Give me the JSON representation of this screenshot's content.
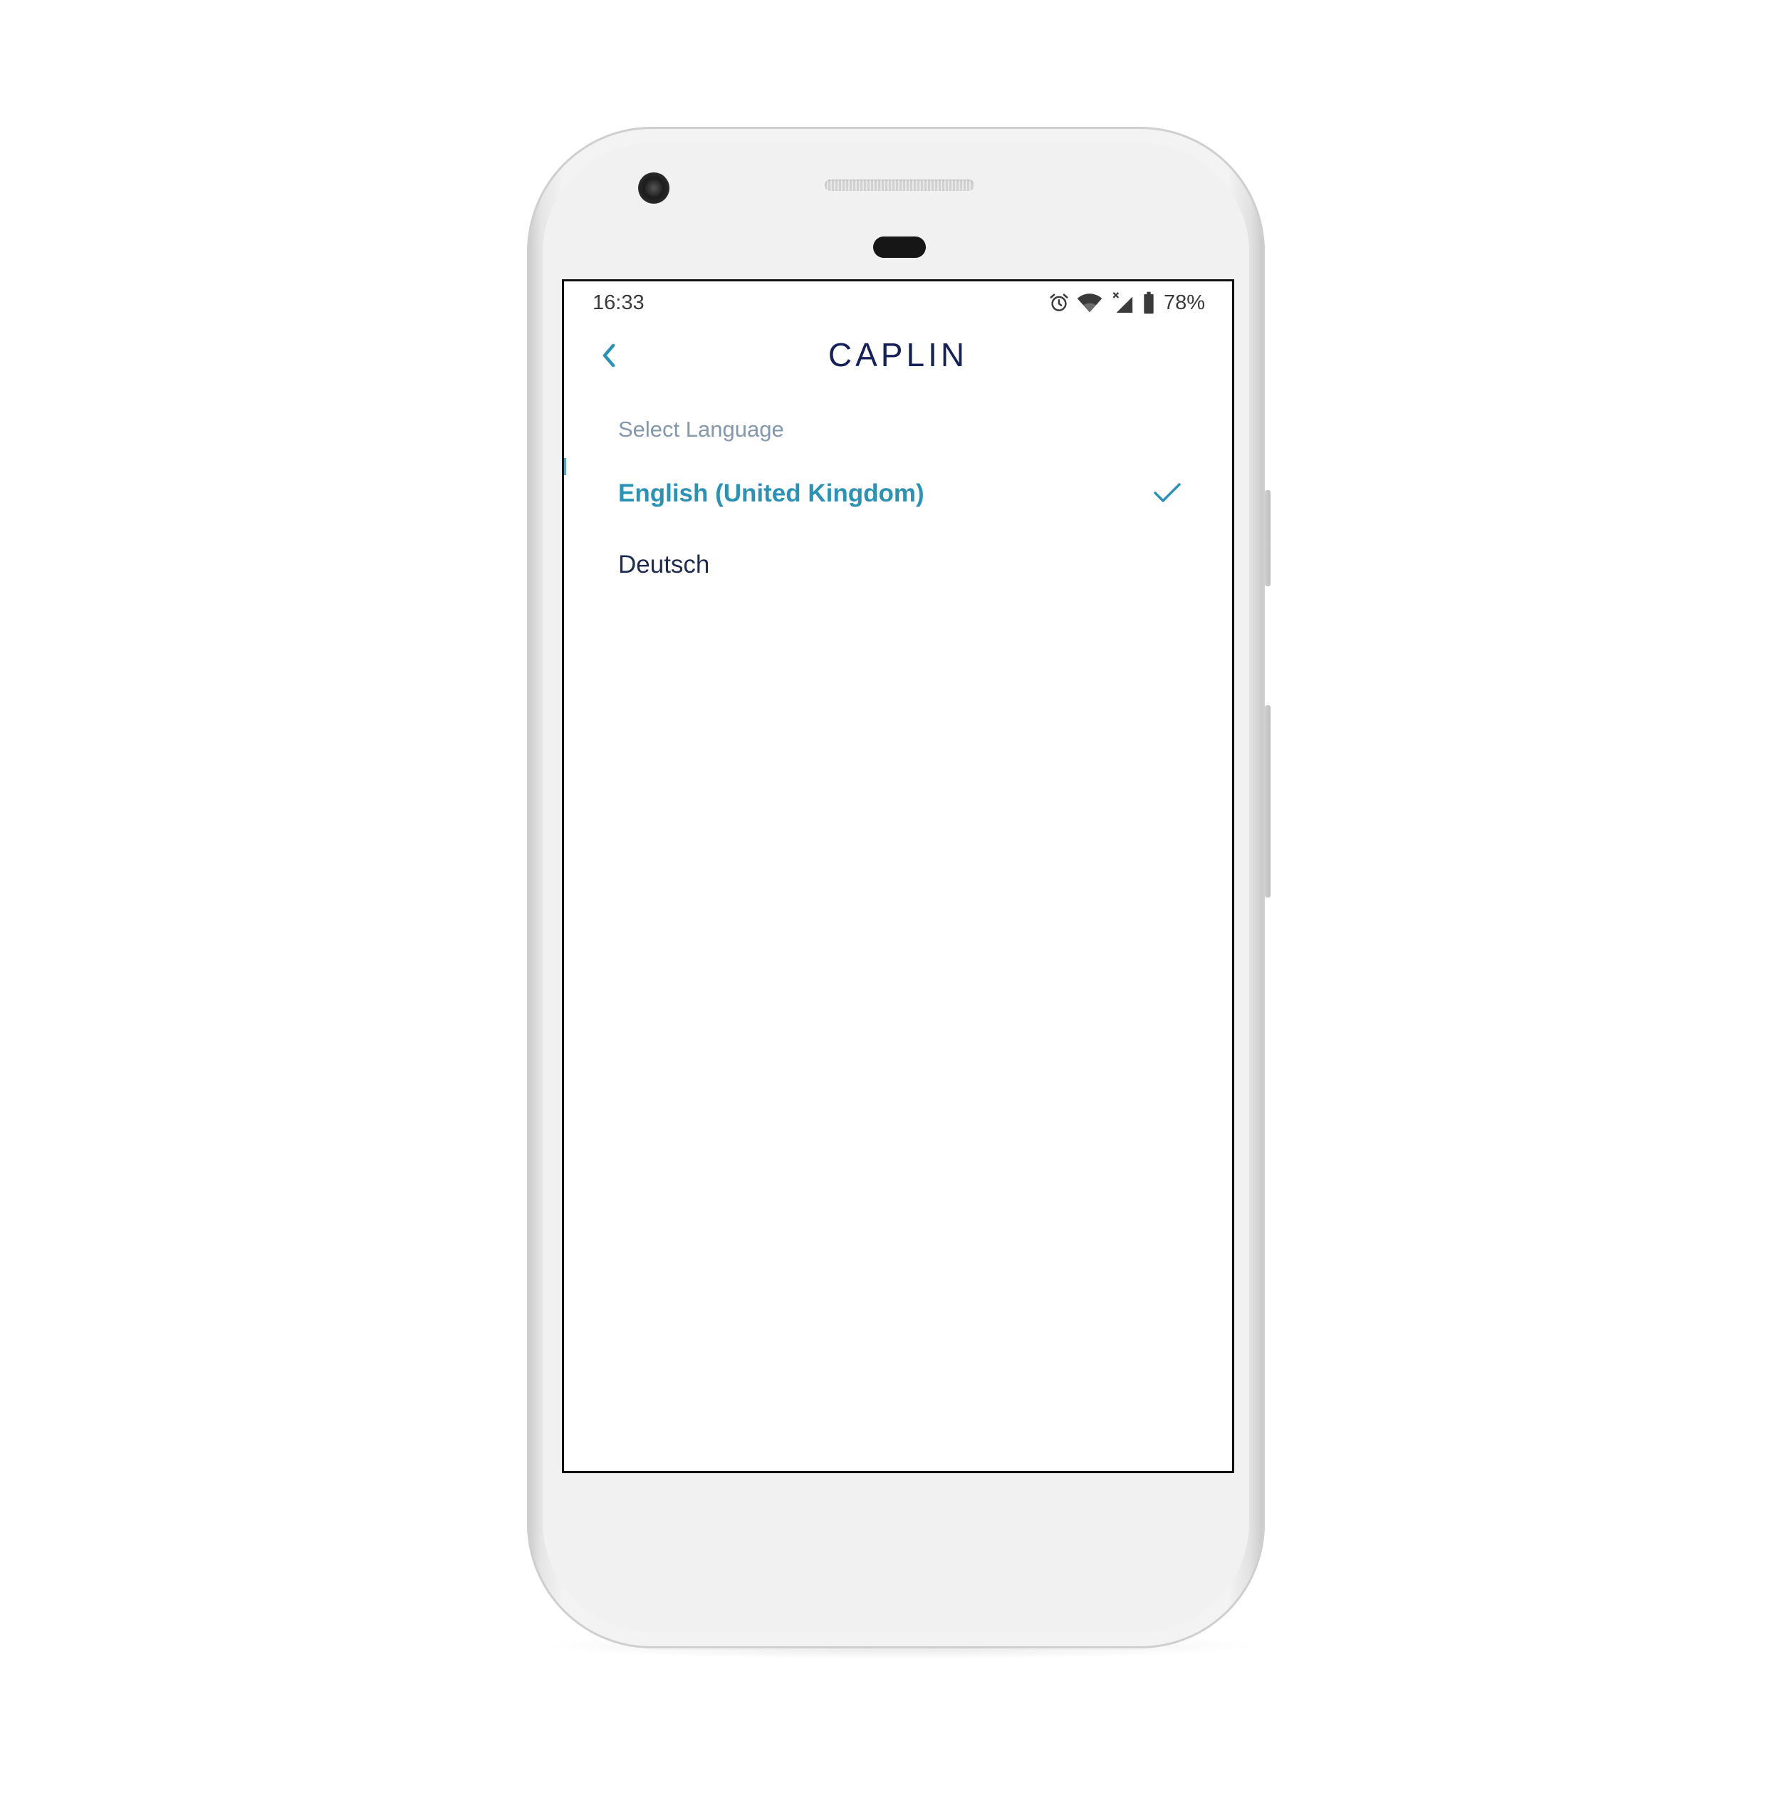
{
  "status_bar": {
    "time": "16:33",
    "battery": "78%",
    "icons": [
      "alarm-icon",
      "wifi-icon",
      "signal-icon",
      "battery-icon"
    ]
  },
  "header": {
    "back_icon": "chevron-left-icon",
    "logo": "CAPLIN"
  },
  "language_screen": {
    "section_title": "Select Language",
    "languages": [
      {
        "label": "English (United Kingdom)",
        "selected": true
      },
      {
        "label": "Deutsch",
        "selected": false
      }
    ],
    "selected_icon": "checkmark-icon"
  },
  "colors": {
    "accent": "#2a92b5",
    "brand": "#16215a",
    "muted": "#8497ad",
    "text": "#1c2b4f"
  }
}
